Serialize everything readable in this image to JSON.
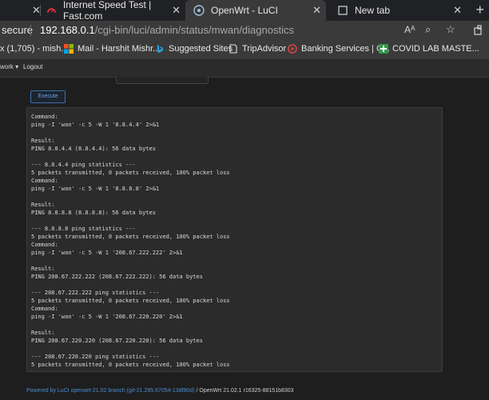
{
  "tabs": [
    {
      "title": "Internet Speed Test | Fast.com",
      "active": false
    },
    {
      "title": "OpenWrt - LuCI",
      "active": true
    },
    {
      "title": "New tab",
      "active": false
    }
  ],
  "address": {
    "security": "secure",
    "host": "192.168.0.1",
    "path": "/cgi-bin/luci/admin/status/mwan/diagnostics",
    "reader_icon": "Aᴬ",
    "zoom_icon": "⌕",
    "star_icon": "☆"
  },
  "bookmarks": [
    {
      "label": "x (1,705) - mish...",
      "icon": "mail-partial-icon"
    },
    {
      "label": "Mail - Harshit Mishr...",
      "icon": "microsoft-icon"
    },
    {
      "label": "Suggested Sites",
      "icon": "bing-icon"
    },
    {
      "label": "TripAdvisor",
      "icon": "page-icon"
    },
    {
      "label": "Banking Services | C...",
      "icon": "bank-icon"
    },
    {
      "label": "COVID LAB MASTE...",
      "icon": "plus-icon"
    }
  ],
  "menu": [
    {
      "label": "work ▾"
    },
    {
      "label": "Logout"
    }
  ],
  "execute_label": "Execute",
  "output_text": "Command:\nping -I 'wan' -c 5 -W 1 '8.8.4.4' 2>&1\n\nResult:\nPING 8.8.4.4 (8.8.4.4): 56 data bytes\n\n--- 8.8.4.4 ping statistics ---\n5 packets transmitted, 0 packets received, 100% packet loss\nCommand:\nping -I 'wan' -c 5 -W 1 '8.8.8.8' 2>&1\n\nResult:\nPING 8.8.8.8 (8.8.8.8): 56 data bytes\n\n--- 8.8.8.8 ping statistics ---\n5 packets transmitted, 0 packets received, 100% packet loss\nCommand:\nping -I 'wan' -c 5 -W 1 '208.67.222.222' 2>&1\n\nResult:\nPING 208.67.222.222 (208.67.222.222): 56 data bytes\n\n--- 208.67.222.222 ping statistics ---\n5 packets transmitted, 0 packets received, 100% packet loss\nCommand:\nping -I 'wan' -c 5 -W 1 '208.67.220.220' 2>&1\n\nResult:\nPING 208.67.220.220 (208.67.220.220): 56 data bytes\n\n--- 208.67.220.220 ping statistics ---\n5 packets transmitted, 0 packets received, 100% packet loss",
  "footer": {
    "link_text": "Powered by LuCI openwrt-21.02 branch (git-21.295.67054-13df80d)",
    "separator": " / ",
    "version_text": "OpenWrt 21.02.1 r16325-88151b8303"
  },
  "colors": {
    "background": "#1e1e1e",
    "panel": "#2b2b2b",
    "link": "#4a8fd6",
    "fast_icon": "#e0313b",
    "covid_icon": "#2e9b4a"
  }
}
